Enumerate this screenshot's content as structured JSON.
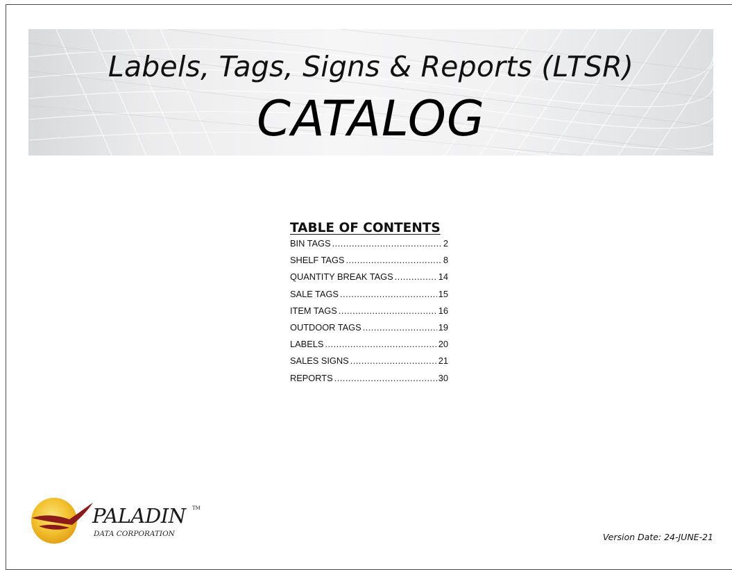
{
  "banner": {
    "title": "Labels, Tags, Signs & Reports (LTSR)",
    "subtitle": "CATALOG"
  },
  "toc": {
    "heading": "TABLE OF CONTENTS",
    "entries": [
      {
        "label": "BIN TAGS",
        "page": "2"
      },
      {
        "label": "SHELF TAGS",
        "page": "8"
      },
      {
        "label": "QUANTITY BREAK TAGS",
        "page": "14"
      },
      {
        "label": "SALE TAGS",
        "page": "15"
      },
      {
        "label": "ITEM TAGS",
        "page": "16"
      },
      {
        "label": "OUTDOOR TAGS",
        "page": "19"
      },
      {
        "label": "LABELS",
        "page": "20"
      },
      {
        "label": "SALES SIGNS",
        "page": "21"
      },
      {
        "label": "REPORTS",
        "page": "30"
      }
    ]
  },
  "logo": {
    "name": "PALADIN",
    "trademark": "TM",
    "subtitle": "DATA CORPORATION",
    "colors": {
      "sun": "#f2c230",
      "sun_edge": "#e3a218",
      "bird": "#8b1a1a"
    }
  },
  "footer": {
    "version_date": "Version Date:  24-JUNE-21"
  }
}
